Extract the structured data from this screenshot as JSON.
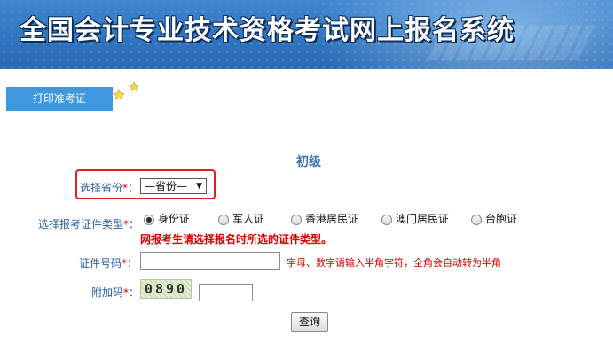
{
  "banner": {
    "title": "全国会计专业技术资格考试网上报名系统"
  },
  "tabs": {
    "print_label": "打印准考证"
  },
  "form": {
    "level": "初级",
    "required_mark": "*",
    "province": {
      "label": "选择省份",
      "value": "—省份—"
    },
    "id_type": {
      "label": "选择报考证件类型",
      "options": [
        "身份证",
        "军人证",
        "香港居民证",
        "澳门居民证",
        "台胞证"
      ],
      "selected": "身份证",
      "warning": "网报考生请选择报名时所选的证件类型。"
    },
    "id_number": {
      "label": "证件号码",
      "value": "",
      "hint": "字母、数字请输入半角字符，全角会自动转为半角"
    },
    "captcha": {
      "label": "附加码",
      "image_text": "0890",
      "value": ""
    },
    "submit_label": "查询"
  },
  "colors": {
    "tab_blue": "#3f97e0",
    "label_blue": "#2a5f9e",
    "warn_red": "#d40000",
    "highlight_box": "#e02020"
  }
}
